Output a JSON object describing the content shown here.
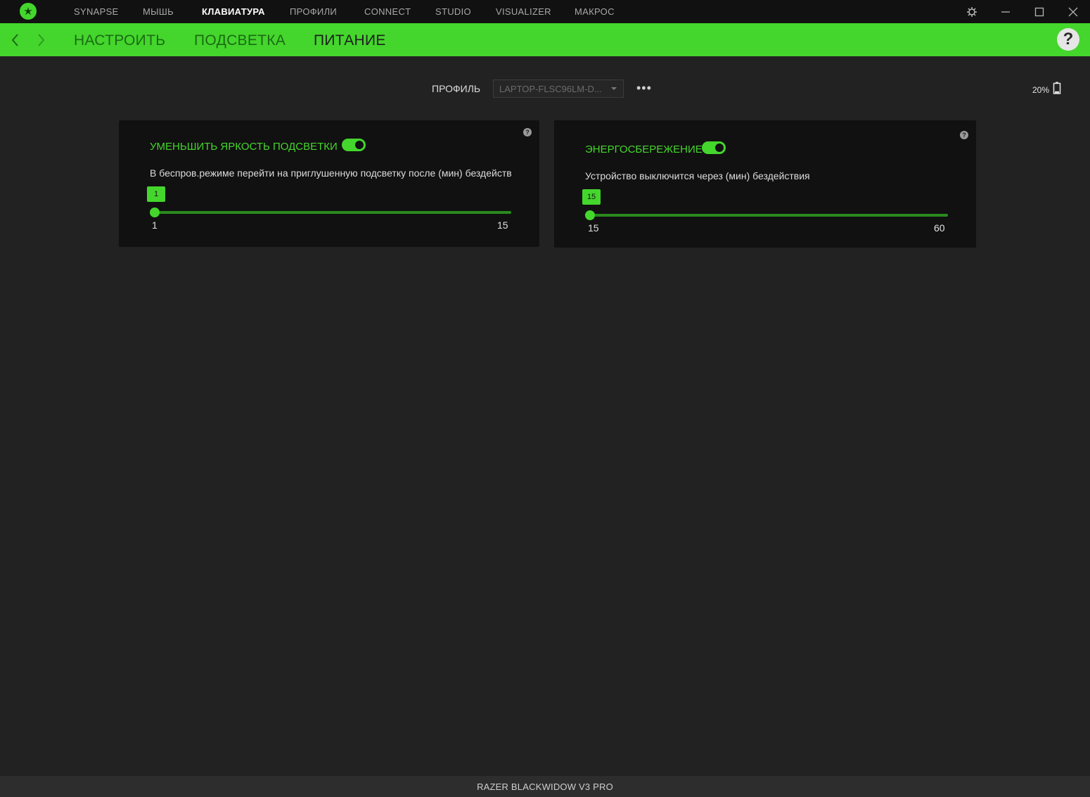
{
  "titlebar": {
    "nav": [
      "SYNAPSE",
      "МЫШЬ",
      "КЛАВИАТУРА",
      "ПРОФИЛИ",
      "CONNECT",
      "STUDIO",
      "VISUALIZER",
      "МАКРОС"
    ],
    "active_nav": "КЛАВИАТУРА"
  },
  "subnav": {
    "tabs": [
      "НАСТРОИТЬ",
      "ПОДСВЕТКА",
      "ПИТАНИЕ"
    ],
    "active_tab": "ПИТАНИЕ",
    "help_label": "?"
  },
  "profile": {
    "label": "ПРОФИЛЬ",
    "selected": "LAPTOP-FLSC96LM-D...",
    "more_label": "•••"
  },
  "battery": {
    "percent_text": "20%",
    "level": 0.2
  },
  "cards": {
    "dim_lighting": {
      "title": "УМЕНЬШИТЬ ЯРКОСТЬ ПОДСВЕТКИ",
      "enabled": true,
      "description": "В беспров.режиме перейти на приглушенную подсветку после (мин) бездействия",
      "value": "1",
      "min": "1",
      "max": "15",
      "help_label": "?"
    },
    "power_saving": {
      "title": "ЭНЕРГОСБЕРЕЖЕНИЕ",
      "enabled": true,
      "description": "Устройство выключится через (мин) бездействия",
      "value": "15",
      "min": "15",
      "max": "60",
      "help_label": "?"
    }
  },
  "footer": {
    "device_name": "RAZER BLACKWIDOW V3 PRO"
  },
  "colors": {
    "accent": "#44d62c",
    "background": "#222222",
    "card": "#111111",
    "titlebar": "#111111"
  }
}
